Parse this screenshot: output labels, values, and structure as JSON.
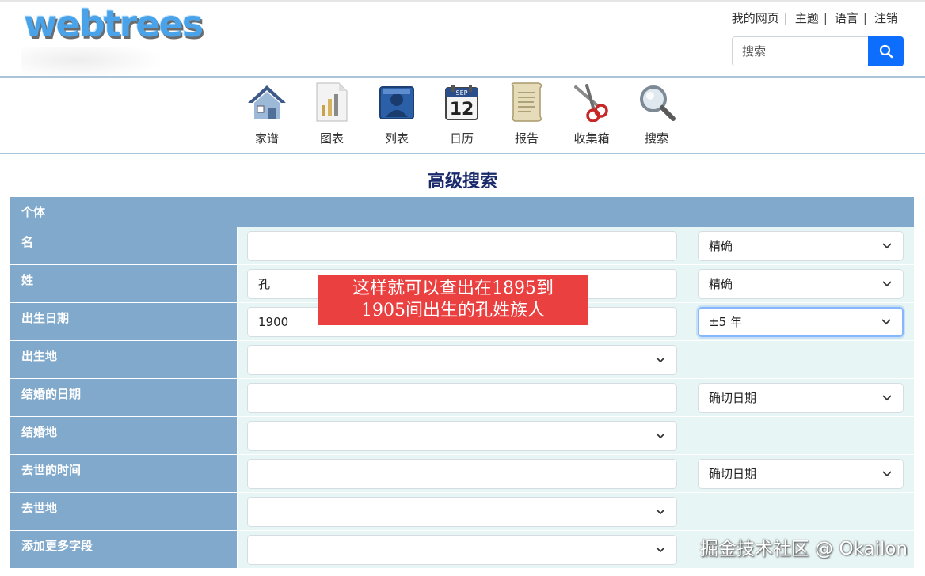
{
  "header": {
    "logo_text": "webtrees",
    "menu": [
      "我的网页",
      "主题",
      "语言",
      "注销"
    ],
    "search_placeholder": "搜索"
  },
  "nav": [
    {
      "label": "家谱",
      "icon": "house-icon"
    },
    {
      "label": "图表",
      "icon": "chart-icon"
    },
    {
      "label": "列表",
      "icon": "list-icon"
    },
    {
      "label": "日历",
      "icon": "calendar-icon"
    },
    {
      "label": "报告",
      "icon": "report-scroll-icon"
    },
    {
      "label": "收集箱",
      "icon": "scissors-icon"
    },
    {
      "label": "搜索",
      "icon": "magnifier-icon"
    }
  ],
  "calendar_icon": {
    "month": "SEP",
    "day": "12"
  },
  "page_title": "高级搜索",
  "form": {
    "section": "个体",
    "rows": [
      {
        "label": "名",
        "value": "",
        "option": "精确"
      },
      {
        "label": "姓",
        "value": "孔",
        "option": "精确"
      },
      {
        "label": "出生日期",
        "value": "1900",
        "option": "±5 年"
      },
      {
        "label": "出生地",
        "value": ""
      },
      {
        "label": "结婚的日期",
        "value": "",
        "option": "确切日期"
      },
      {
        "label": "结婚地",
        "value": ""
      },
      {
        "label": "去世的时间",
        "value": "",
        "option": "确切日期"
      },
      {
        "label": "去世地",
        "value": ""
      },
      {
        "label": "添加更多字段",
        "value": ""
      }
    ]
  },
  "annotation": {
    "line1": "这样就可以查出在1895到",
    "line2": "1905间出生的孔姓族人"
  },
  "watermark": "掘金技术社区 @ Okailon",
  "colors": {
    "accent": "#0d6efd",
    "label_bg": "#81a9cb",
    "cell_bg": "#e8f5f5",
    "title": "#1a2a6c",
    "callout": "#ea4040"
  }
}
